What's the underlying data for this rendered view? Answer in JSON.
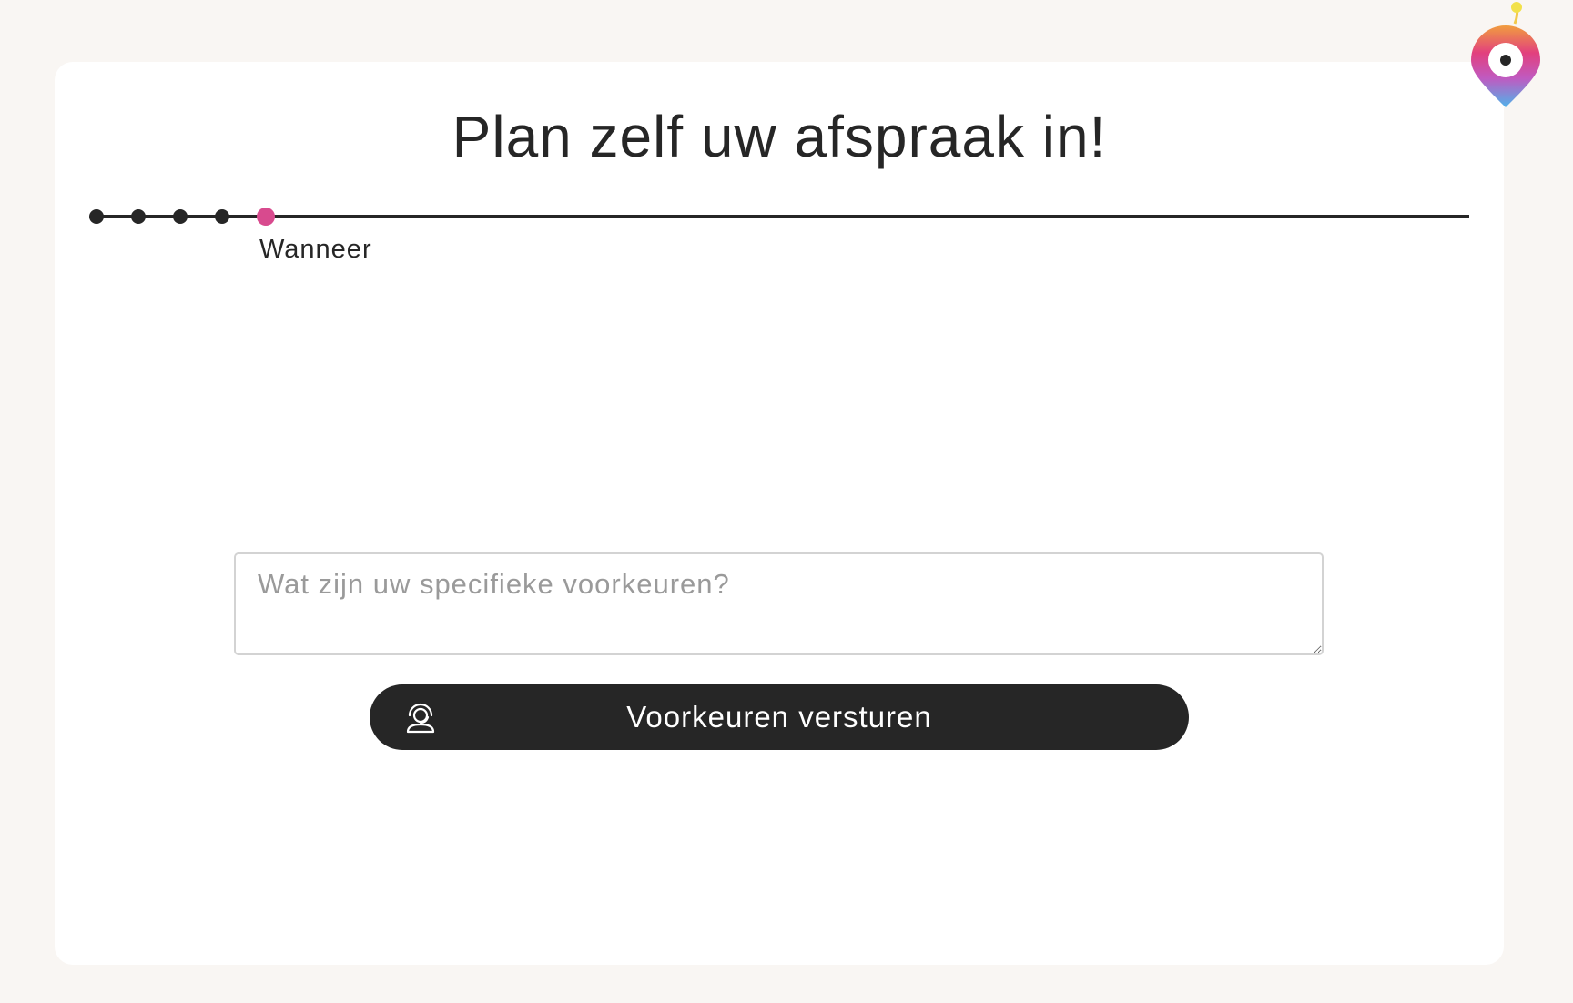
{
  "page": {
    "title": "Plan zelf uw afspraak in!"
  },
  "progress": {
    "current_step_label": "Wanneer",
    "steps_total": 5,
    "current_step": 5
  },
  "preferences": {
    "placeholder": "Wat zijn uw specifieke voorkeuren?",
    "value": ""
  },
  "submit": {
    "label": "Voorkeuren versturen",
    "icon": "support-agent-icon"
  },
  "logo": {
    "icon": "location-pin-logo-icon"
  },
  "colors": {
    "background": "#f9f6f3",
    "card": "#ffffff",
    "text": "#262626",
    "accent": "#d84a8e",
    "button": "#262626",
    "placeholder": "#9a9a9a"
  }
}
